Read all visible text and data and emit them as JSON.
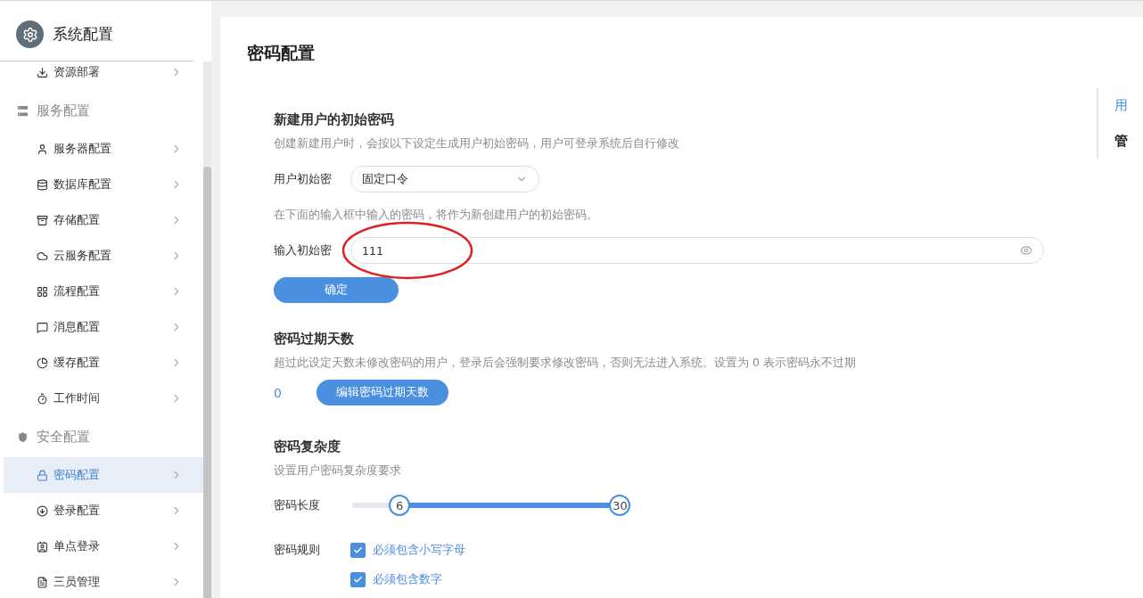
{
  "sidebar": {
    "title": "系统配置",
    "items": [
      {
        "kind": "link",
        "label": "资源部署",
        "selected": false
      },
      {
        "kind": "group",
        "label": "服务配置"
      },
      {
        "kind": "link",
        "label": "服务器配置",
        "selected": false
      },
      {
        "kind": "link",
        "label": "数据库配置",
        "selected": false
      },
      {
        "kind": "link",
        "label": "存储配置",
        "selected": false
      },
      {
        "kind": "link",
        "label": "云服务配置",
        "selected": false
      },
      {
        "kind": "link",
        "label": "流程配置",
        "selected": false
      },
      {
        "kind": "link",
        "label": "消息配置",
        "selected": false
      },
      {
        "kind": "link",
        "label": "缓存配置",
        "selected": false
      },
      {
        "kind": "link",
        "label": "工作时间",
        "selected": false
      },
      {
        "kind": "group",
        "label": "安全配置"
      },
      {
        "kind": "link",
        "label": "密码配置",
        "selected": true
      },
      {
        "kind": "link",
        "label": "登录配置",
        "selected": false
      },
      {
        "kind": "link",
        "label": "单点登录",
        "selected": false
      },
      {
        "kind": "link",
        "label": "三员管理",
        "selected": false
      }
    ]
  },
  "page": {
    "title": "密码配置",
    "initial_password": {
      "heading": "新建用户的初始密码",
      "description": "创建新建用户时，会按以下设定生成用户初始密码，用户可登录系统后自行修改",
      "mode_label": "用户初始密",
      "mode_value": "固定口令",
      "hint": "在下面的输入框中输入的密码，将作为新创建用户的初始密码。",
      "input_label": "输入初始密",
      "input_value": "111",
      "confirm": "确定"
    },
    "expiry": {
      "heading": "密码过期天数",
      "description": "超过此设定天数未修改密码的用户，登录后会强制要求修改密码，否则无法进入系统。设置为 0 表示密码永不过期",
      "value": "0",
      "edit": "编辑密码过期天数"
    },
    "complexity": {
      "heading": "密码复杂度",
      "description": "设置用户密码复杂度要求",
      "length_label": "密码长度",
      "thumbs": [
        {
          "label": "6",
          "level": 0.17
        },
        {
          "label": "30",
          "level": 0.96
        }
      ],
      "rules_label": "密码规则",
      "rules": [
        {
          "label": "必须包含小写字母",
          "checked": true
        },
        {
          "label": "必须包含数字",
          "checked": true
        }
      ]
    }
  },
  "anchors": [
    {
      "label": "用",
      "selected": true
    },
    {
      "label": "管",
      "selected": false
    }
  ],
  "annotation": {
    "kind": "ellipse"
  }
}
